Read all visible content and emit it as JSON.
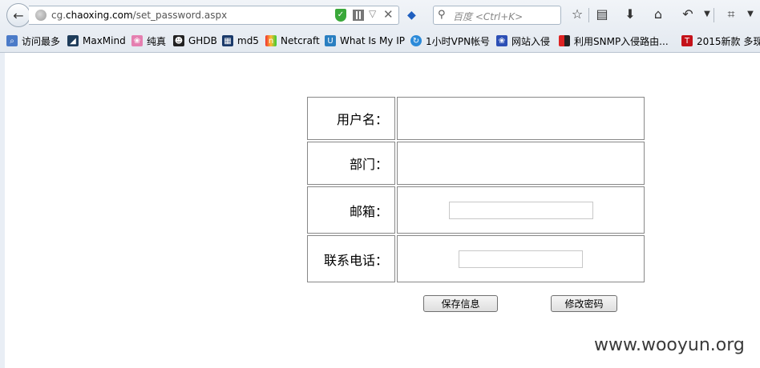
{
  "browser": {
    "url_prefix": "cg.",
    "url_domain": "chaoxing.com",
    "url_path": "/set_password.aspx",
    "search_placeholder": "百度 <Ctrl+K>",
    "bookmarks": [
      "访问最多",
      "MaxMind",
      "纯真",
      "GHDB",
      "md5",
      "Netcraft",
      "What Is My IP",
      "1小时VPN帐号",
      "网站入侵",
      "利用SNMP入侵路由...",
      "2015新款 多现"
    ]
  },
  "form": {
    "username_label": "用户名：",
    "username_value": "",
    "department_label": "部门：",
    "department_value": "",
    "email_label": "邮箱：",
    "email_value": "",
    "phone_label": "联系电话：",
    "phone_value": ""
  },
  "actions": {
    "save_label": "保存信息",
    "change_password_label": "修改密码"
  },
  "watermark": "www.wooyun.org"
}
